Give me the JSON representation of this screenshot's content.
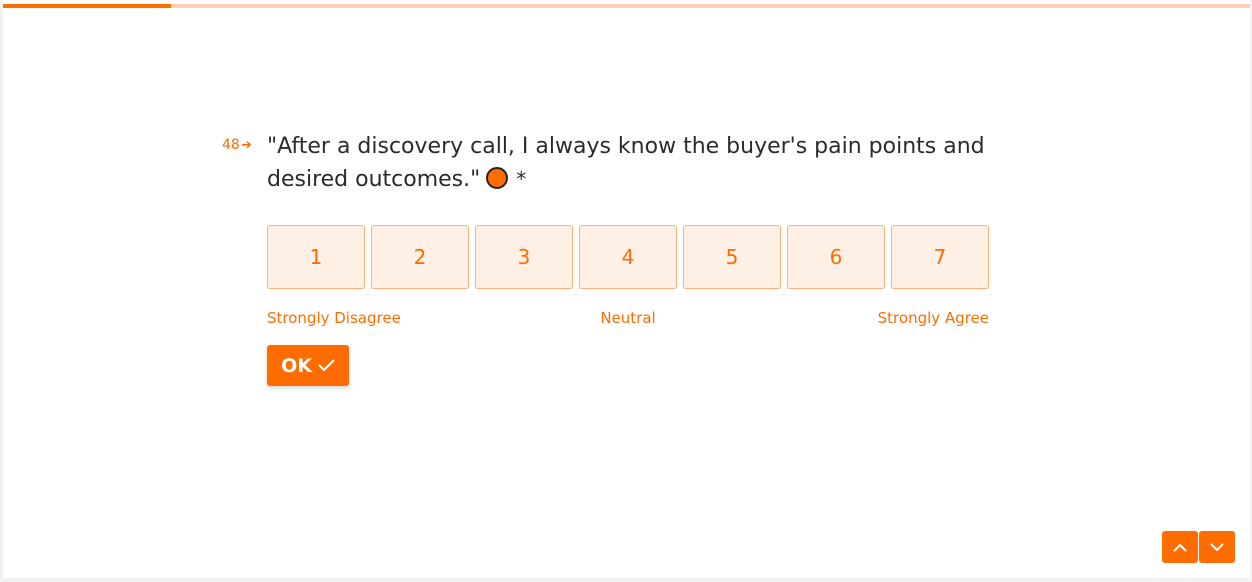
{
  "progress": {
    "fraction": 0.135
  },
  "question": {
    "number": "48",
    "arrow_icon": "arrow-right-icon",
    "text": "\"After a discovery call, I always know the buyer's pain points and desired outcomes.\"",
    "marker_icon": "orange-circle-icon",
    "required_mark": "*"
  },
  "scale": {
    "options": [
      "1",
      "2",
      "3",
      "4",
      "5",
      "6",
      "7"
    ],
    "label_left": "Strongly Disagree",
    "label_middle": "Neutral",
    "label_right": "Strongly Agree"
  },
  "ok_button": {
    "label": "OK",
    "icon": "check-icon"
  },
  "navigation": {
    "up_icon": "chevron-up-icon",
    "down_icon": "chevron-down-icon"
  },
  "colors": {
    "accent": "#ff6d00",
    "accent_light": "#fff0e6",
    "accent_border": "#ffb07a",
    "progress_track": "#ffd0b3",
    "text": "#2b2b2b"
  }
}
